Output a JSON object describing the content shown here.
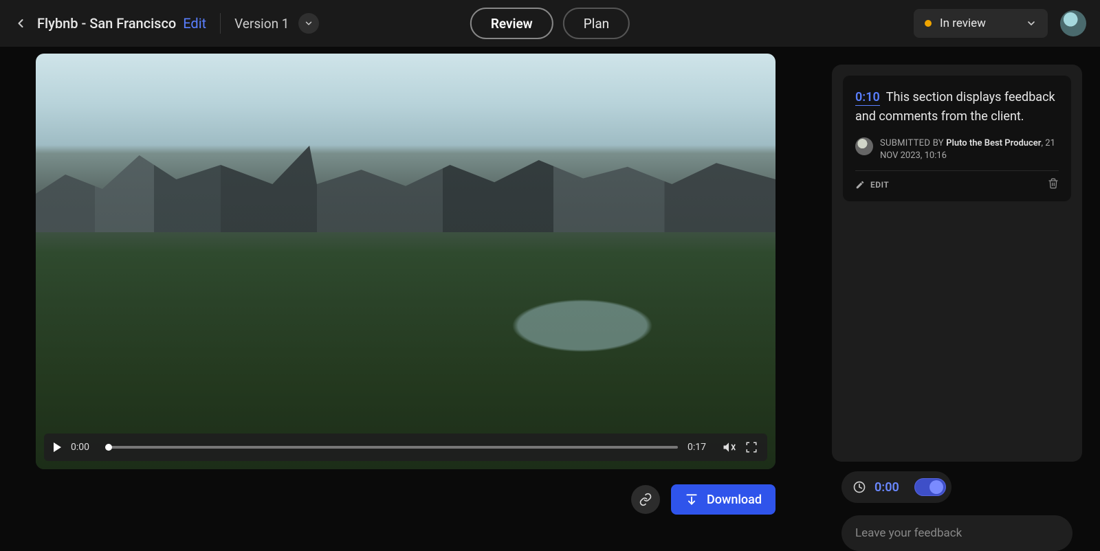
{
  "header": {
    "project_title": "Flybnb - San Francisco",
    "edit_label": "Edit",
    "version_label": "Version 1",
    "tabs": {
      "review": "Review",
      "plan": "Plan"
    },
    "status": {
      "label": "In review",
      "color": "#f0a500"
    }
  },
  "video": {
    "current_time": "0:00",
    "duration": "0:17"
  },
  "actions": {
    "download": "Download"
  },
  "comments": [
    {
      "timecode": "0:10",
      "text": "This section displays feedback and comments from the client.",
      "submitted_by_label": "SUBMITTED BY",
      "author": "Pluto the Best Producer",
      "datetime": "21 NOV 2023, 10:16",
      "edit_label": "EDIT"
    }
  ],
  "timestamp_widget": {
    "time": "0:00"
  },
  "feedback": {
    "placeholder": "Leave your feedback"
  }
}
